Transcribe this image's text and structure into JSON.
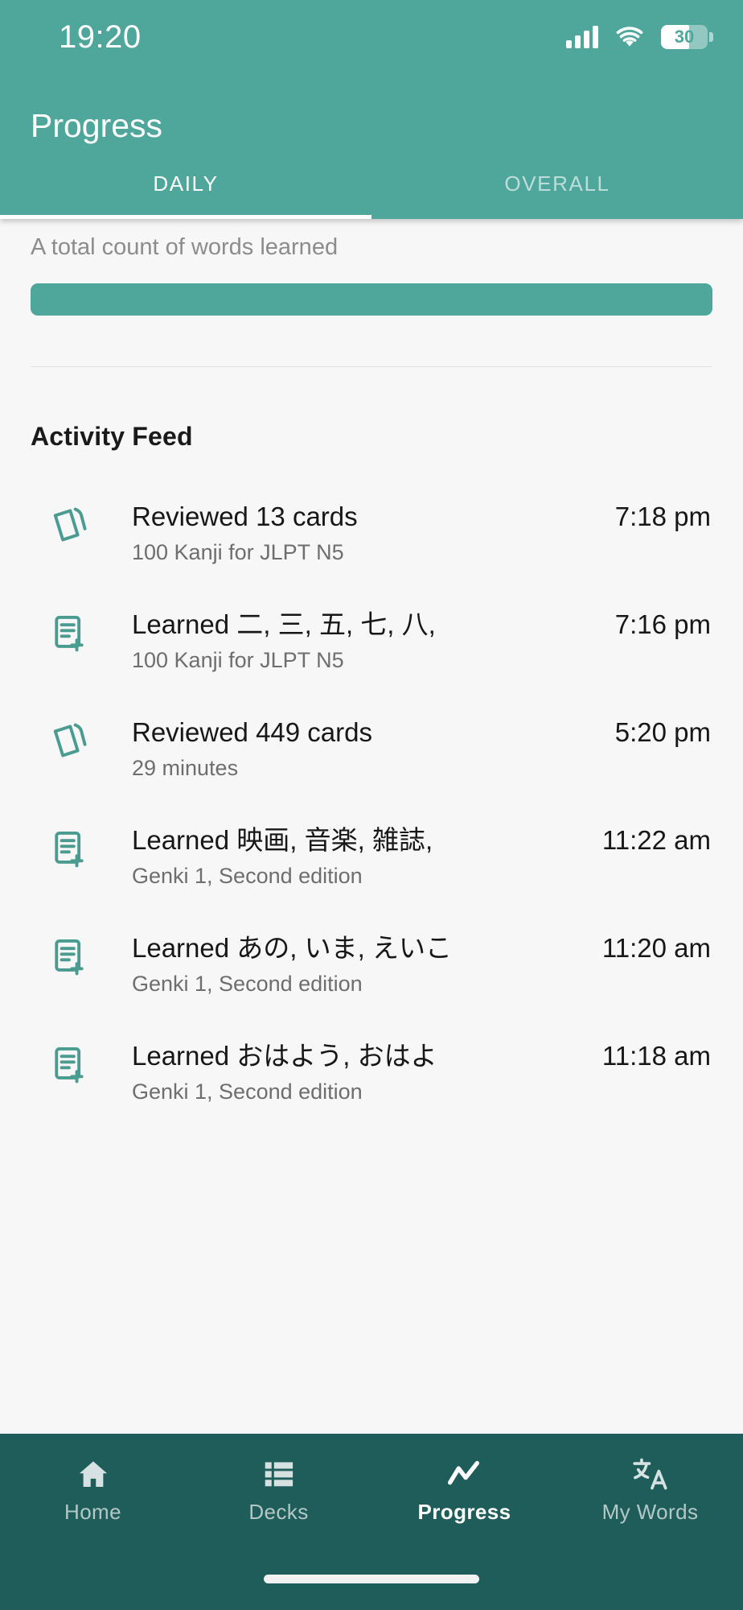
{
  "status_bar": {
    "time": "19:20",
    "battery_level": "30",
    "signal_icon": "cellular-signal-icon",
    "wifi_icon": "wifi-icon",
    "battery_icon": "battery-icon"
  },
  "header": {
    "title": "Progress"
  },
  "tabs": [
    {
      "label": "DAILY",
      "active": true
    },
    {
      "label": "OVERALL",
      "active": false
    }
  ],
  "summary": {
    "label": "A total count of words learned",
    "bar_color": "#4FA79B"
  },
  "feed": {
    "title": "Activity Feed",
    "items": [
      {
        "icon": "cards-stack-icon",
        "heading": "Reviewed 13 cards",
        "subtitle": "100 Kanji for JLPT N5",
        "time": "7:18 pm"
      },
      {
        "icon": "note-add-icon",
        "heading": "Learned 二, 三, 五, 七, 八,",
        "subtitle": "100 Kanji for JLPT N5",
        "time": "7:16 pm"
      },
      {
        "icon": "cards-stack-icon",
        "heading": "Reviewed 449 cards",
        "subtitle": "29 minutes",
        "time": "5:20 pm"
      },
      {
        "icon": "note-add-icon",
        "heading": "Learned 映画, 音楽, 雑誌,",
        "subtitle": "Genki 1, Second edition",
        "time": "11:22 am"
      },
      {
        "icon": "note-add-icon",
        "heading": "Learned あの, いま, えいこ",
        "subtitle": "Genki 1, Second edition",
        "time": "11:20 am"
      },
      {
        "icon": "note-add-icon",
        "heading": "Learned おはよう, おはよ",
        "subtitle": "Genki 1, Second edition",
        "time": "11:18 am"
      }
    ]
  },
  "bottom_nav": {
    "items": [
      {
        "label": "Home",
        "icon": "home-icon",
        "active": false
      },
      {
        "label": "Decks",
        "icon": "list-icon",
        "active": false
      },
      {
        "label": "Progress",
        "icon": "chart-line-icon",
        "active": true
      },
      {
        "label": "My Words",
        "icon": "translate-icon",
        "active": false
      }
    ]
  },
  "theme": {
    "primary": "#4FA79B",
    "nav_background": "#1E5D5A",
    "page_background": "#F7F7F7",
    "accent_icon": "#4A9C90"
  }
}
